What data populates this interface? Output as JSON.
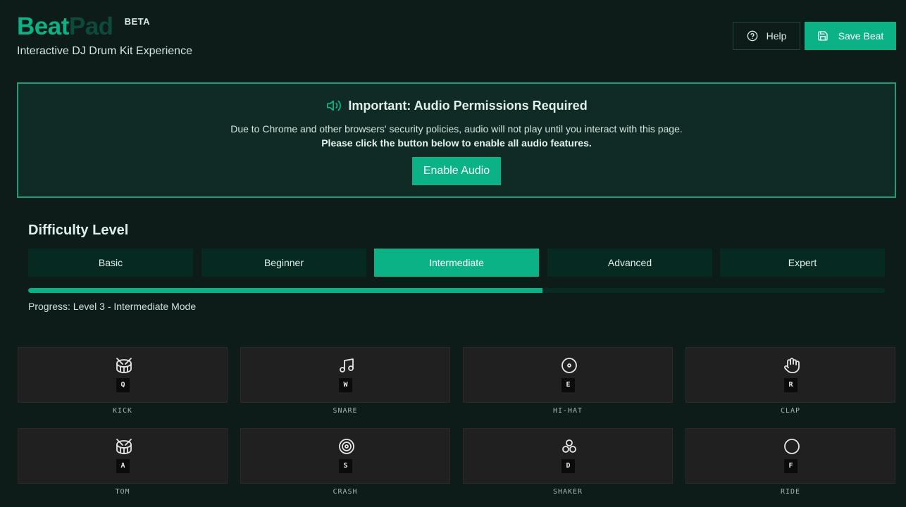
{
  "header": {
    "logo_part1": "Beat",
    "logo_part2": "Pad",
    "badge": "BETA",
    "subtitle": "Interactive DJ Drum Kit Experience",
    "help_label": "Help",
    "save_label": "Save Beat"
  },
  "notice": {
    "title": "Important: Audio Permissions Required",
    "line1": "Due to Chrome and other browsers' security policies, audio will not play until you interact with this page.",
    "line2": "Please click the button below to enable all audio features.",
    "button_label": "Enable Audio"
  },
  "difficulty": {
    "title": "Difficulty Level",
    "levels": [
      "Basic",
      "Beginner",
      "Intermediate",
      "Advanced",
      "Expert"
    ],
    "selected": "Intermediate",
    "progress_fraction": 0.6,
    "progress_text": "Progress: Level 3 - Intermediate Mode"
  },
  "pads": [
    {
      "key": "Q",
      "label": "KICK",
      "icon": "drum-icon"
    },
    {
      "key": "W",
      "label": "SNARE",
      "icon": "music-note-icon"
    },
    {
      "key": "E",
      "label": "HI-HAT",
      "icon": "disc-icon"
    },
    {
      "key": "R",
      "label": "CLAP",
      "icon": "hand-icon"
    },
    {
      "key": "A",
      "label": "TOM",
      "icon": "drum-icon"
    },
    {
      "key": "S",
      "label": "CRASH",
      "icon": "target-icon"
    },
    {
      "key": "D",
      "label": "SHAKER",
      "icon": "cluster-icon"
    },
    {
      "key": "F",
      "label": "RIDE",
      "icon": "circle-icon"
    }
  ],
  "colors": {
    "background": "#0d1b19",
    "accent": "#0ab285",
    "notice_border": "#16a17a",
    "pad": "#202020"
  }
}
